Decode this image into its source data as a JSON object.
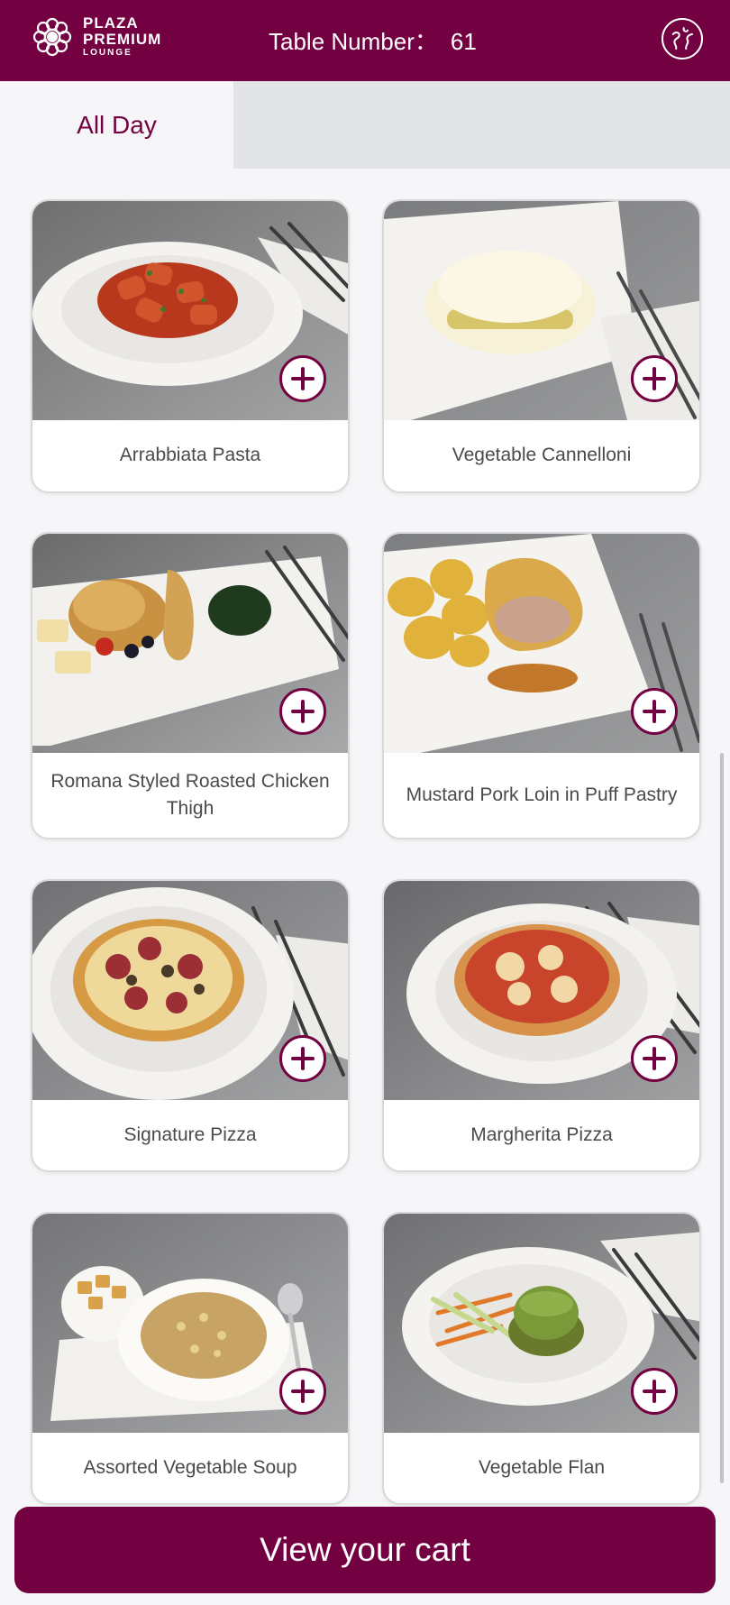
{
  "header": {
    "brand": {
      "line1": "PLAZA",
      "line2": "PREMIUM",
      "line3": "LOUNGE",
      "icon": "plaza-premium-lounge-logo"
    },
    "table_label": "Table Number：",
    "table_number": "61",
    "language_icon": "globe-icon"
  },
  "tabs": [
    {
      "label": "All Day",
      "active": true
    }
  ],
  "menu": {
    "items": [
      {
        "name": "Arrabbiata Pasta",
        "photo": "penne pasta in tomato sauce on white plate"
      },
      {
        "name": "Vegetable Cannelloni",
        "photo": "cannelloni with white sauce on rectangular plate"
      },
      {
        "name": "Romana Styled Roasted Chicken Thigh",
        "photo": "roasted chicken with vegetables and spinach"
      },
      {
        "name": "Mustard Pork Loin in Puff Pastry",
        "photo": "pork loin in pastry with potatoes"
      },
      {
        "name": "Signature Pizza",
        "photo": "pizza with salami and mushrooms"
      },
      {
        "name": "Margherita Pizza",
        "photo": "margherita pizza on white plate"
      },
      {
        "name": "Assorted Vegetable Soup",
        "photo": "chickpea soup with croutons"
      },
      {
        "name": "Vegetable Flan",
        "photo": "spinach flan with salad"
      }
    ],
    "add_icon": "plus-circle-icon"
  },
  "cart": {
    "label": "View your cart"
  },
  "colors": {
    "brand": "#730040",
    "background": "#f6f6f8",
    "tab_inactive": "#e3e4e6"
  }
}
